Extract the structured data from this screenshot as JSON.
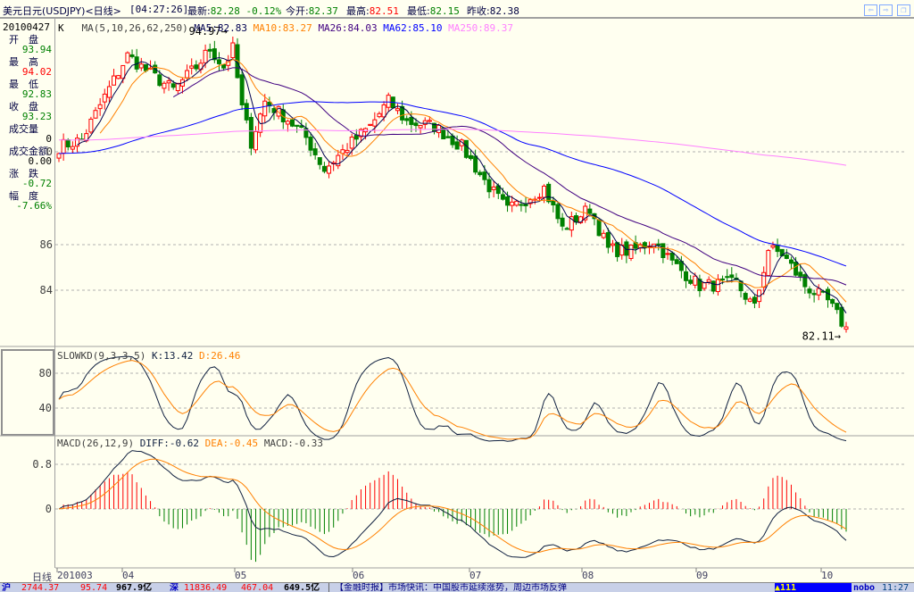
{
  "header": {
    "name": "美元日元(USDJPY)<日线>",
    "time": "[04:27:26]",
    "latest_label": "最新:",
    "latest": "82.28",
    "change": "-0.12%",
    "open_label": "今开:",
    "open": "82.37",
    "high_label": "最高:",
    "high": "82.51",
    "low_label": "最低:",
    "low": "82.15",
    "prev_label": "昨收:",
    "prev": "82.38"
  },
  "nav": {
    "back": "⇦",
    "forward": "⇨",
    "restore": "❐"
  },
  "info": {
    "date": "20100427",
    "items": [
      {
        "label": "开　盘",
        "value": "93.94",
        "color": "g"
      },
      {
        "label": "最　高",
        "value": "94.02",
        "color": "r"
      },
      {
        "label": "最　低",
        "value": "92.83",
        "color": "g"
      },
      {
        "label": "收　盘",
        "value": "93.23",
        "color": "g"
      },
      {
        "label": "成交量",
        "value": "0",
        "color": ""
      },
      {
        "label": "成交金额",
        "value": "0.00",
        "color": ""
      },
      {
        "label": "涨　跌",
        "value": "-0.72",
        "color": "g"
      },
      {
        "label": "幅　度",
        "value": "-7.66%",
        "color": "g"
      }
    ]
  },
  "ma_legend": {
    "k": "K",
    "params": "MA(5,10,26,62,250)",
    "ma5": "MA5:82.83",
    "ma10": "MA10:83.27",
    "ma26": "MA26:84.03",
    "ma62": "MA62:85.10",
    "ma250": "MA250:89.37"
  },
  "kd_legend": {
    "name": "SLOWKD(9,3,3,5)",
    "k": "K:13.42",
    "d": "D:26.46"
  },
  "macd_legend": {
    "name": "MACD(26,12,9)",
    "diff": "DIFF:-0.62",
    "dea": "DEA:-0.45",
    "macd": "MACD:-0.33"
  },
  "axis": {
    "period": "日线",
    "months": [
      "201003",
      "04",
      "05",
      "06",
      "07",
      "08",
      "09",
      "10"
    ]
  },
  "status": {
    "sh_label": "沪",
    "sh_index": "2744.37",
    "sh_chg": "95.74",
    "sh_amt": "967.9亿",
    "sz_label": "深",
    "sz_index": "11836.49",
    "sz_chg": "467.04",
    "sz_amt": "649.5亿",
    "news": "【金融时报】市场快讯：中国股市延续涨势，周边市场反弹",
    "alert": "▲111",
    "brand": "nobo",
    "clock": "11:27"
  },
  "colors": {
    "up": "#ff0000",
    "down": "#008000",
    "ma5": "#000050",
    "ma10": "#ff8000",
    "ma26": "#400080",
    "ma62": "#0000ff",
    "ma250": "#ff80ff",
    "k": "#102040",
    "d": "#ff8000"
  },
  "chart_data": {
    "type": "candlestick",
    "price_ticks": [
      86,
      84
    ],
    "kd_ticks": [
      80,
      40
    ],
    "macd_ticks": [
      0.8,
      0
    ],
    "high_mark": "94.97",
    "low_mark": "82.11",
    "trend_points": [
      [
        0,
        90.3
      ],
      [
        5,
        90.6
      ],
      [
        10,
        92.5
      ],
      [
        15,
        94.3
      ],
      [
        20,
        93.5
      ],
      [
        25,
        92.8
      ],
      [
        30,
        93.8
      ],
      [
        33,
        94.6
      ],
      [
        36,
        93.8
      ],
      [
        38,
        94.6
      ],
      [
        40,
        92.0
      ],
      [
        42,
        90.5
      ],
      [
        45,
        92.3
      ],
      [
        50,
        91.5
      ],
      [
        54,
        90.7
      ],
      [
        58,
        89.3
      ],
      [
        63,
        90.3
      ],
      [
        68,
        91.2
      ],
      [
        72,
        92.3
      ],
      [
        76,
        91.4
      ],
      [
        82,
        91.2
      ],
      [
        88,
        90.3
      ],
      [
        93,
        88.8
      ],
      [
        98,
        87.5
      ],
      [
        102,
        88.0
      ],
      [
        106,
        88.5
      ],
      [
        110,
        86.7
      ],
      [
        116,
        87.6
      ],
      [
        120,
        85.8
      ],
      [
        125,
        85.7
      ],
      [
        130,
        86.2
      ],
      [
        134,
        85.2
      ],
      [
        140,
        84.2
      ],
      [
        148,
        84.3
      ],
      [
        152,
        83.2
      ],
      [
        155,
        85.8
      ],
      [
        158,
        85.6
      ],
      [
        163,
        84.2
      ],
      [
        168,
        83.5
      ],
      [
        172,
        82.3
      ]
    ]
  }
}
